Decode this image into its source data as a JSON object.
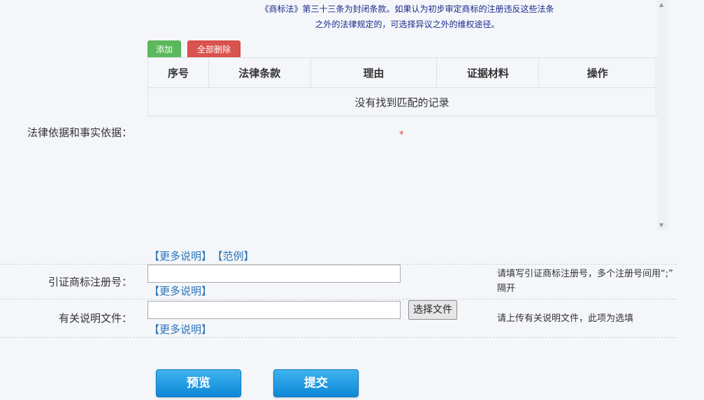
{
  "notice": {
    "line1": "《商标法》第三十三条为封闭条款。如果认为初步审定商标的注册违反这些法条",
    "line2": "之外的法律规定的，可选择异议之外的维权途径。"
  },
  "toolbar": {
    "add_label": "添加",
    "delete_all_label": "全部删除"
  },
  "table": {
    "headers": [
      "序号",
      "法律条款",
      "理由",
      "证据材料",
      "操作"
    ],
    "empty_text": "没有找到匹配的记录"
  },
  "legal_basis": {
    "label": "法律依据和事实依据：",
    "required_mark": "*"
  },
  "links": {
    "more_info": "【更多说明】",
    "example": "【范例】"
  },
  "cited_mark": {
    "label": "引证商标注册号：",
    "value": "",
    "hint_line1": "请填写引证商标注册号，多个注册号间用“;”",
    "hint_line2": "隔开"
  },
  "doc": {
    "label": "有关说明文件：",
    "value": "",
    "file_button": "选择文件",
    "hint": "请上传有关说明文件，此项为选填"
  },
  "actions": {
    "preview_label": "预览",
    "submit_label": "提交"
  },
  "colors": {
    "add_green": "#5cb85c",
    "delete_red": "#d9534f",
    "link_blue": "#2a72b8",
    "button_blue": "#0d87d6"
  }
}
